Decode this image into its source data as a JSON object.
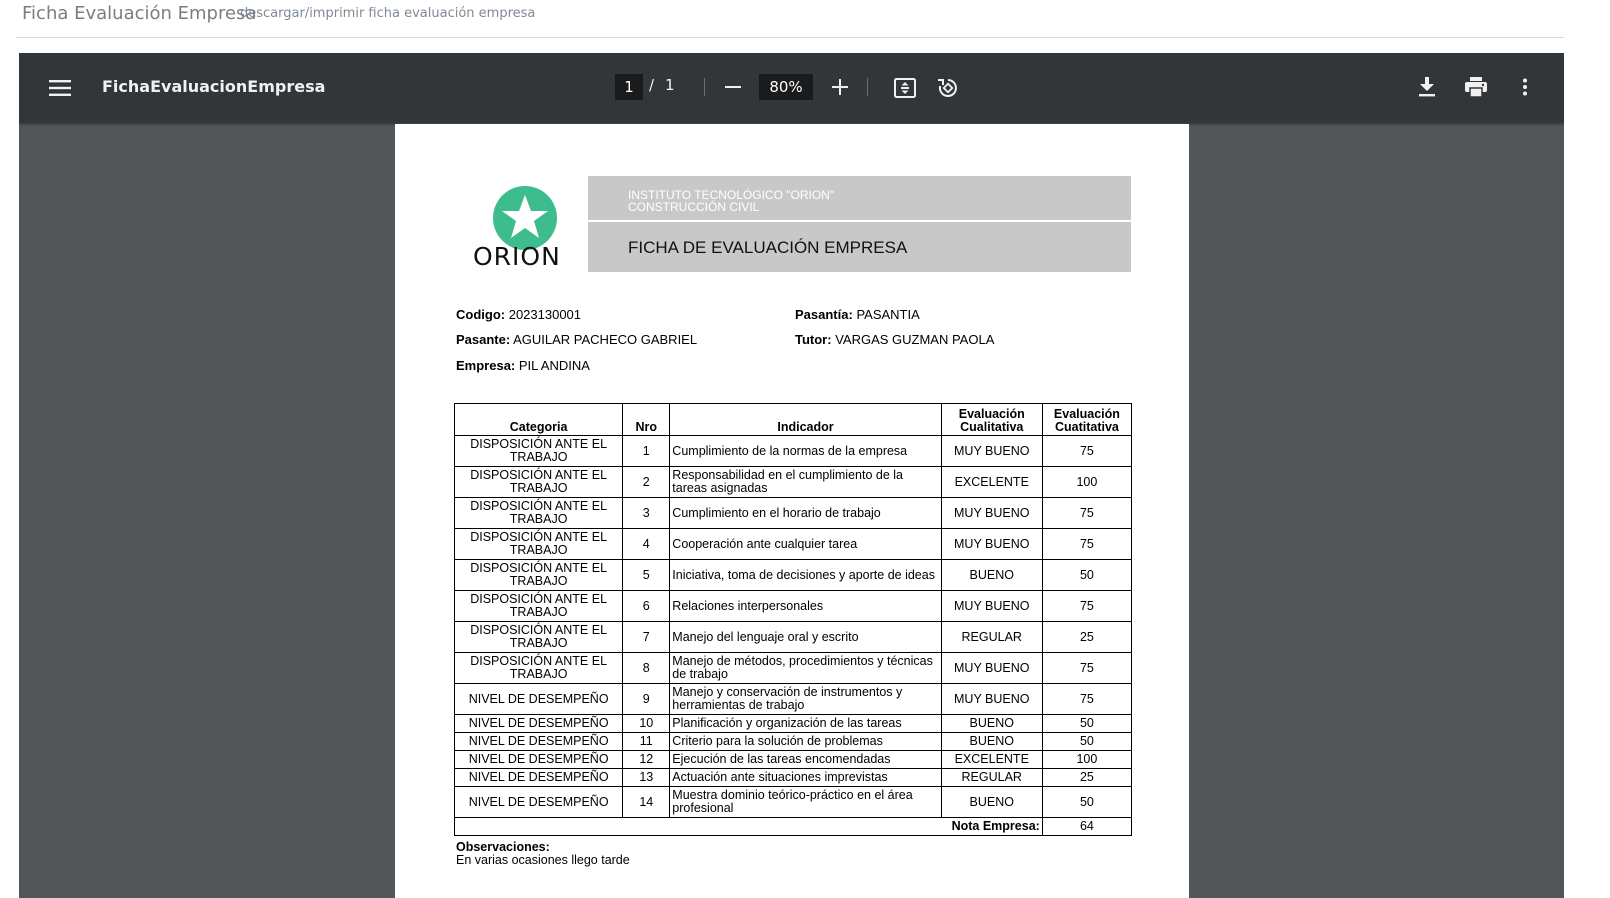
{
  "page": {
    "title": "Ficha Evaluación Empresa",
    "subtitle": "descargar/imprimir ficha evaluación empresa"
  },
  "toolbar": {
    "menu_icon": "hamburger-menu-icon",
    "document_title": "FichaEvaluacionEmpresa",
    "current_page": "1",
    "page_separator": "/",
    "total_pages": "1",
    "zoom": "80%",
    "icons": [
      "zoom-out-icon",
      "zoom-in-icon",
      "fit-page-icon",
      "rotate-icon",
      "download-icon",
      "print-icon",
      "more-options-icon"
    ]
  },
  "document": {
    "logo_text": "ORION",
    "logo_color": "#3dbd8d",
    "institute_line1": "INSTITUTO TECNOLÓGICO  \"ORION\"",
    "institute_line2": "CONSTRUCCIÓN CIVIL",
    "form_title": "FICHA DE EVALUACIÓN EMPRESA",
    "fields": {
      "codigo_label": "Codigo:",
      "codigo_value": "2023130001",
      "pasantia_label": "Pasantía:",
      "pasantia_value": "PASANTIA",
      "pasante_label": "Pasante:",
      "pasante_value": "AGUILAR PACHECO GABRIEL",
      "tutor_label": "Tutor:",
      "tutor_value": "VARGAS  GUZMAN PAOLA",
      "empresa_label": "Empresa:",
      "empresa_value": "PIL ANDINA"
    },
    "table": {
      "headers": [
        "Categoria",
        "Nro",
        "Indicador",
        "Evaluación Cualitativa",
        "Evaluación Cuatitativa"
      ],
      "rows": [
        {
          "categoria": "DISPOSICIÓN ANTE EL TRABAJO",
          "nro": "1",
          "indicador": "Cumplimiento de la normas de la empresa",
          "cualitativa": "MUY BUENO",
          "cuantitativa": "75"
        },
        {
          "categoria": "DISPOSICIÓN ANTE EL TRABAJO",
          "nro": "2",
          "indicador": "Responsabilidad en el cumplimiento de la tareas asignadas",
          "cualitativa": "EXCELENTE",
          "cuantitativa": "100"
        },
        {
          "categoria": "DISPOSICIÓN ANTE EL TRABAJO",
          "nro": "3",
          "indicador": "Cumplimiento en el horario de trabajo",
          "cualitativa": "MUY BUENO",
          "cuantitativa": "75"
        },
        {
          "categoria": "DISPOSICIÓN ANTE EL TRABAJO",
          "nro": "4",
          "indicador": "Cooperación ante cualquier tarea",
          "cualitativa": "MUY BUENO",
          "cuantitativa": "75"
        },
        {
          "categoria": "DISPOSICIÓN ANTE EL TRABAJO",
          "nro": "5",
          "indicador": "Iniciativa, toma de decisiones y aporte de ideas",
          "cualitativa": "BUENO",
          "cuantitativa": "50"
        },
        {
          "categoria": "DISPOSICIÓN ANTE EL TRABAJO",
          "nro": "6",
          "indicador": "Relaciones interpersonales",
          "cualitativa": "MUY BUENO",
          "cuantitativa": "75"
        },
        {
          "categoria": "DISPOSICIÓN ANTE EL TRABAJO",
          "nro": "7",
          "indicador": "Manejo del lenguaje oral y escrito",
          "cualitativa": "REGULAR",
          "cuantitativa": "25"
        },
        {
          "categoria": "DISPOSICIÓN ANTE EL TRABAJO",
          "nro": "8",
          "indicador": "Manejo de métodos, procedimientos y técnicas de trabajo",
          "cualitativa": "MUY BUENO",
          "cuantitativa": "75"
        },
        {
          "categoria": "NIVEL DE DESEMPEÑO",
          "nro": "9",
          "indicador": "Manejo y conservación de instrumentos y herramientas de trabajo",
          "cualitativa": "MUY BUENO",
          "cuantitativa": "75"
        },
        {
          "categoria": "NIVEL DE DESEMPEÑO",
          "nro": "10",
          "indicador": "Planificación y organización de las tareas",
          "cualitativa": "BUENO",
          "cuantitativa": "50"
        },
        {
          "categoria": "NIVEL DE DESEMPEÑO",
          "nro": "11",
          "indicador": "Criterio para la solución de problemas",
          "cualitativa": "BUENO",
          "cuantitativa": "50"
        },
        {
          "categoria": "NIVEL DE DESEMPEÑO",
          "nro": "12",
          "indicador": "Ejecución de las tareas encomendadas",
          "cualitativa": "EXCELENTE",
          "cuantitativa": "100"
        },
        {
          "categoria": "NIVEL DE DESEMPEÑO",
          "nro": "13",
          "indicador": "Actuación ante situaciones imprevistas",
          "cualitativa": "REGULAR",
          "cuantitativa": "25"
        },
        {
          "categoria": "NIVEL DE DESEMPEÑO",
          "nro": "14",
          "indicador": "Muestra dominio teórico-práctico en el área profesional",
          "cualitativa": "BUENO",
          "cuantitativa": "50"
        }
      ],
      "total_label": "Nota Empresa:",
      "total_value": "64"
    },
    "observaciones_label": "Observaciones:",
    "observaciones_text": "En varias ocasiones llego tarde"
  }
}
